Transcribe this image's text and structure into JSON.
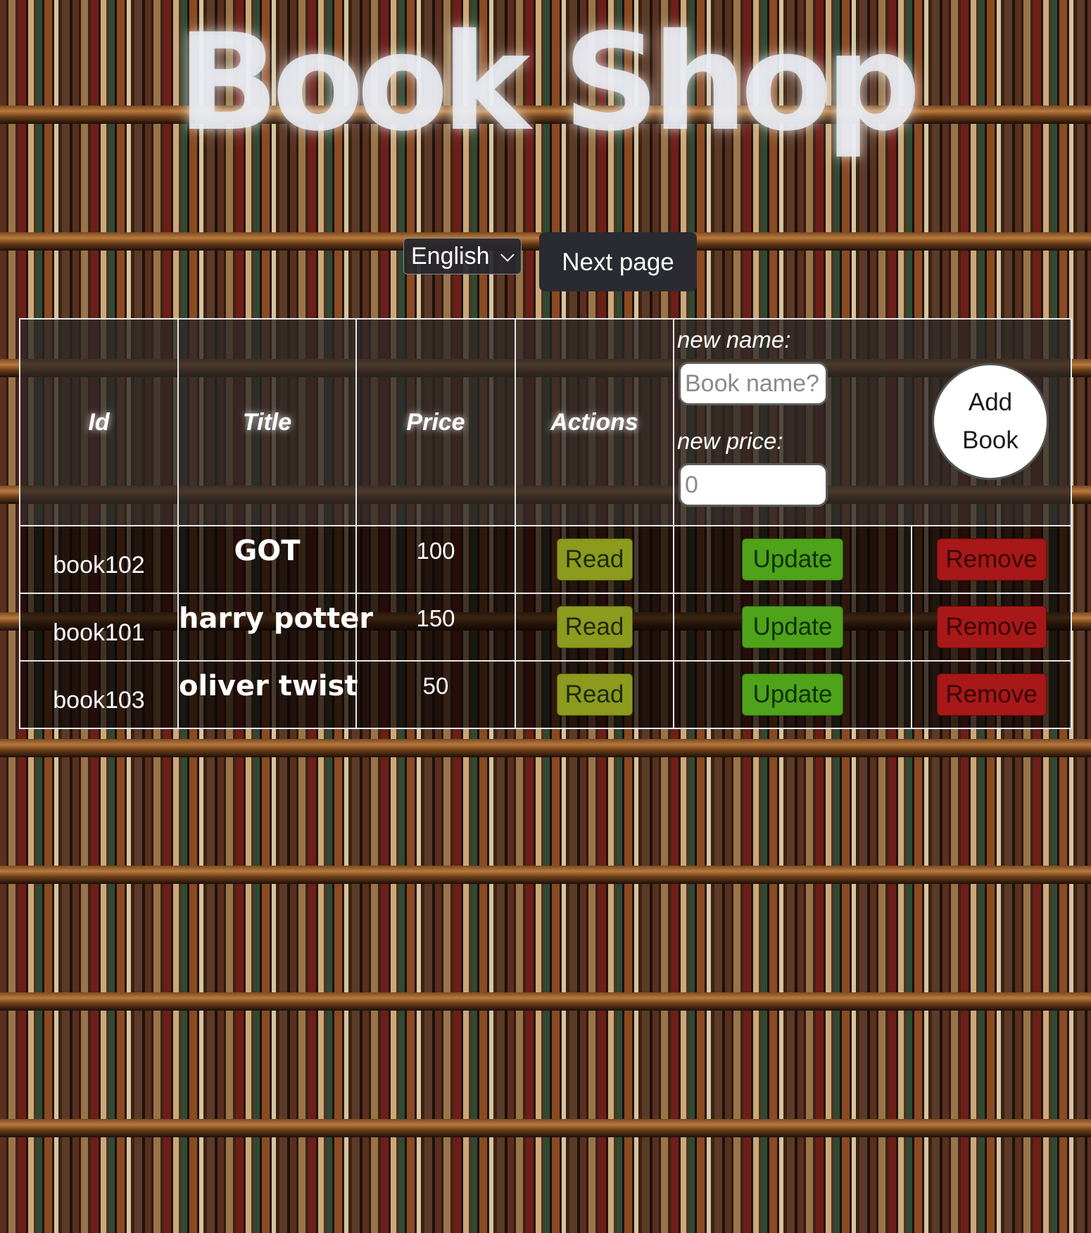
{
  "header": {
    "title": "Book Shop"
  },
  "controls": {
    "language": {
      "selected": "English"
    },
    "next_page_label": "Next page"
  },
  "table": {
    "columns": {
      "id": "Id",
      "title": "Title",
      "price": "Price",
      "actions": "Actions"
    },
    "add_form": {
      "name_label": "new name:",
      "name_placeholder": "Book name?",
      "price_label": "new price:",
      "price_value": "0",
      "add_button_line1": "Add",
      "add_button_line2": "Book"
    },
    "rows": [
      {
        "id": "book102",
        "title": "GOT",
        "price": "100",
        "read": "Read",
        "update": "Update",
        "remove": "Remove"
      },
      {
        "id": "book101",
        "title": "harry potter",
        "price": "150",
        "read": "Read",
        "update": "Update",
        "remove": "Remove"
      },
      {
        "id": "book103",
        "title": "oliver twist",
        "price": "50",
        "read": "Read",
        "update": "Update",
        "remove": "Remove"
      }
    ]
  },
  "colors": {
    "read_button": "#8c9a1e",
    "update_button": "#4ea31a",
    "remove_button": "#a81818"
  }
}
